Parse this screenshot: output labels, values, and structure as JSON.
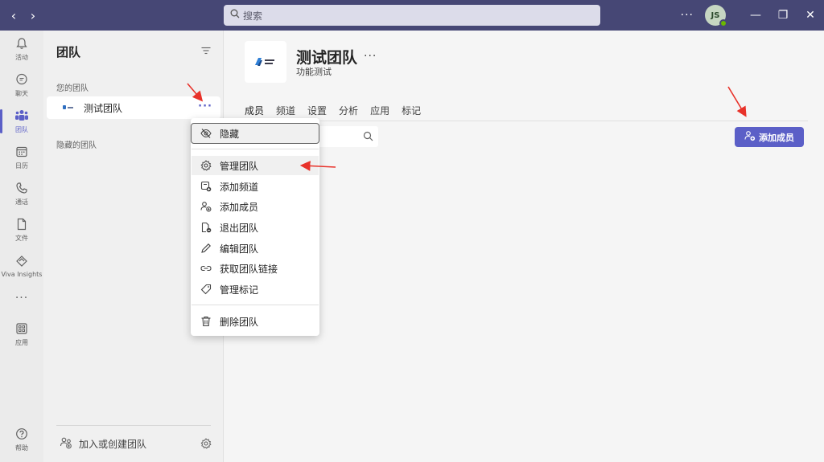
{
  "titlebar": {
    "back": "‹",
    "forward": "›",
    "search_placeholder": "搜索",
    "more": "···",
    "avatar_initials": "JS",
    "minimize": "—",
    "restore": "❐",
    "close": "✕"
  },
  "rail": {
    "items": [
      {
        "label": "活动",
        "icon": "bell-icon"
      },
      {
        "label": "聊天",
        "icon": "chat-icon"
      },
      {
        "label": "团队",
        "icon": "teams-icon",
        "active": true
      },
      {
        "label": "日历",
        "icon": "calendar-icon"
      },
      {
        "label": "通话",
        "icon": "phone-icon"
      },
      {
        "label": "文件",
        "icon": "file-icon"
      },
      {
        "label": "Viva Insights",
        "icon": "viva-insights-icon"
      }
    ],
    "more": "···",
    "apps_label": "应用",
    "help_label": "帮助"
  },
  "pane": {
    "title": "团队",
    "your_teams_label": "您的团队",
    "team_name": "测试团队",
    "team_more": "···",
    "hidden_teams_label": "隐藏的团队",
    "join_label": "加入或创建团队"
  },
  "main": {
    "team_title": "测试团队",
    "title_more": "···",
    "subtitle": "功能测试",
    "tabs": [
      "成员",
      "频道",
      "设置",
      "分析",
      "应用",
      "标记"
    ],
    "add_member_label": "添加成员"
  },
  "context_menu": {
    "items": [
      {
        "label": "隐藏",
        "icon": "eye-off-icon"
      },
      {
        "label": "管理团队",
        "icon": "gear-icon"
      },
      {
        "label": "添加频道",
        "icon": "add-channel-icon"
      },
      {
        "label": "添加成员",
        "icon": "add-person-icon"
      },
      {
        "label": "退出团队",
        "icon": "leave-team-icon"
      },
      {
        "label": "编辑团队",
        "icon": "pencil-icon"
      },
      {
        "label": "获取团队链接",
        "icon": "link-icon"
      },
      {
        "label": "管理标记",
        "icon": "tag-icon"
      },
      {
        "label": "删除团队",
        "icon": "trash-icon"
      }
    ]
  },
  "colors": {
    "titlebar": "#464775",
    "accent": "#5b5fc7",
    "annotation": "#e8322a"
  }
}
